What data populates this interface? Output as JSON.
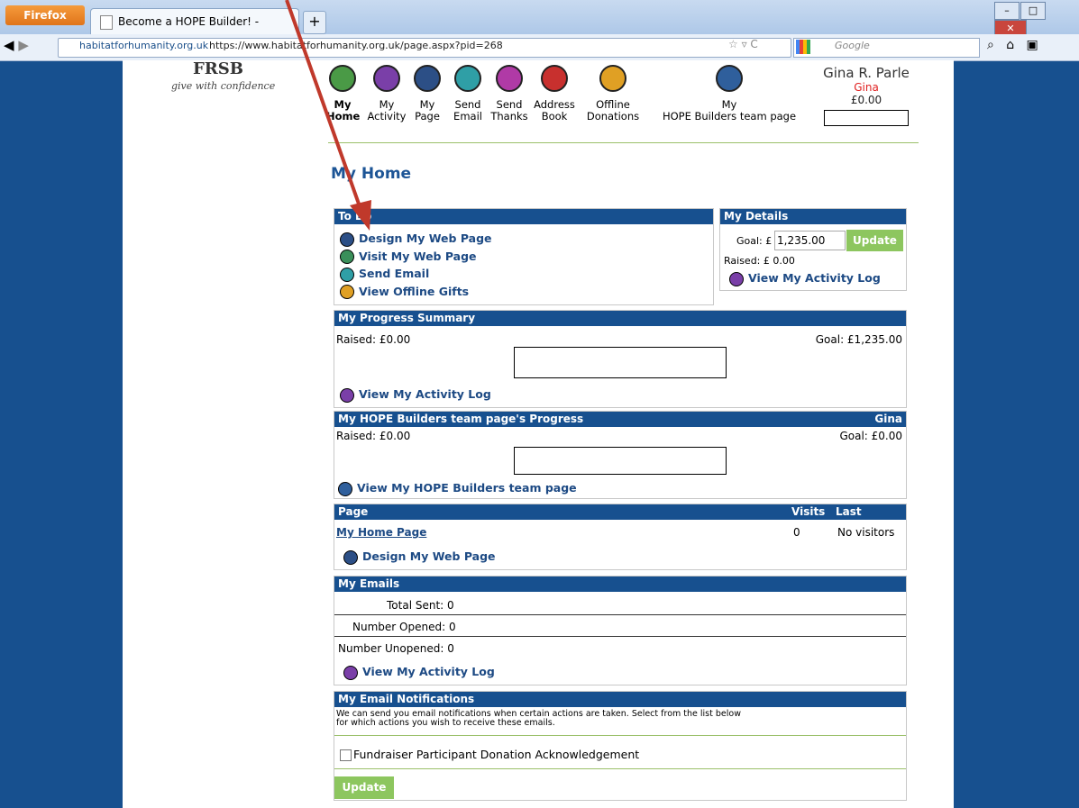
{
  "browser": {
    "app_button": "Firefox",
    "tab_title": "Become a HOPE Builder! - Habitat for H...",
    "new_tab": "+",
    "url_site": "habitatforhumanity.org.uk",
    "url_full": "https://www.habitatforhumanity.org.uk/page.aspx?pid=268",
    "search_placeholder": "Google"
  },
  "logo": {
    "mark": "FRSB",
    "tagline": "give with confidence"
  },
  "nav": [
    {
      "line1": "My",
      "line2": "Home",
      "bold": true,
      "color": "#4a9a46",
      "icon": "home-icon"
    },
    {
      "line1": "My",
      "line2": "Activity",
      "color": "#7a3fa8",
      "icon": "activity-icon"
    },
    {
      "line1": "My",
      "line2": "Page",
      "color": "#2c4f86",
      "icon": "page-icon"
    },
    {
      "line1": "Send",
      "line2": "Email",
      "color": "#2f9fa6",
      "icon": "email-icon"
    },
    {
      "line1": "Send",
      "line2": "Thanks",
      "color": "#b03aa6",
      "icon": "thanks-icon"
    },
    {
      "line1": "Address",
      "line2": "Book",
      "color": "#c8302e",
      "icon": "address-book-icon"
    },
    {
      "line1": "Offline",
      "line2": "Donations",
      "color": "#e0a024",
      "icon": "offline-donations-icon"
    },
    {
      "line1": "My",
      "line2": "HOPE Builders team page",
      "color": "#2f5f9c",
      "icon": "team-icon"
    }
  ],
  "user": {
    "name": "Gina R. Parle",
    "team": "Gina",
    "balance": "£0.00"
  },
  "page_title": "My Home",
  "todo": {
    "header": "To Do",
    "links": [
      {
        "label": "Design My Web Page",
        "color": "#2c4f86"
      },
      {
        "label": "Visit My Web Page",
        "color": "#3a8f5a"
      },
      {
        "label": "Send Email",
        "color": "#2f9fa6"
      },
      {
        "label": "View Offline Gifts",
        "color": "#e0a024"
      }
    ]
  },
  "details": {
    "header": "My Details",
    "goal_label": "Goal: £",
    "goal_value": "1,235.00",
    "update_label": "Update",
    "raised": "Raised: £ 0.00",
    "activity_link": "View My Activity Log"
  },
  "progress": {
    "header": "My Progress Summary",
    "raised": "Raised: £0.00",
    "goal": "Goal: £1,235.00",
    "fraction": 0,
    "link": "View My Activity Log"
  },
  "team_progress": {
    "header": "My HOPE Builders team page's Progress",
    "team": "Gina",
    "raised": "Raised: £0.00",
    "goal": "Goal: £0.00",
    "fraction": 0,
    "link": "View My HOPE Builders team page"
  },
  "pages": {
    "col_page": "Page",
    "col_visits": "Visits",
    "col_last": "Last Visited",
    "row_name": "My Home Page",
    "row_visits": "0",
    "row_last": "No visitors",
    "link": "Design My Web Page"
  },
  "emails": {
    "header": "My Emails",
    "sent_label": "Total Sent:",
    "sent": "0",
    "opened_label": "Number Opened:",
    "opened": "0",
    "unopened_label": "Number Unopened:",
    "unopened": "0",
    "link": "View My Activity Log"
  },
  "notifications": {
    "header": "My Email Notifications",
    "desc1": "We can send you email notifications when certain actions are taken. Select from the list below",
    "desc2": "for which actions you wish to receive these emails.",
    "option": "Fundraiser Participant Donation Acknowledgement",
    "update_label": "Update"
  }
}
